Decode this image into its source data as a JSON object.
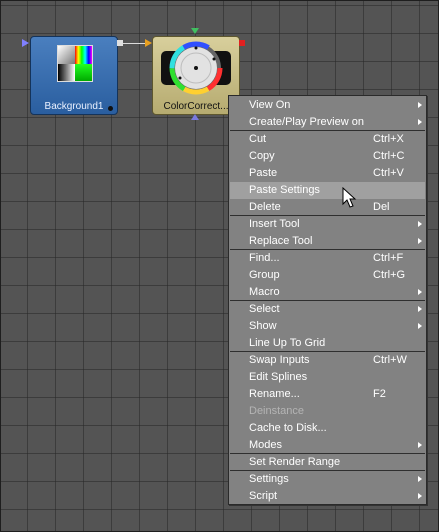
{
  "nodes": {
    "background": {
      "label": "Background1"
    },
    "color_correct": {
      "label": "ColorCorrect..."
    }
  },
  "icons": {
    "background_thumb": "gradient-swatch-icon",
    "color_wheel": "color-wheel-icon",
    "cursor": "mouse-cursor-icon"
  },
  "colors": {
    "canvas": "#545454",
    "background_node": "#3a6fae",
    "color_correct_node": "#c9bf86",
    "menu_bg": "#828282",
    "menu_highlight": "#a0a0a0",
    "menu_text": "#ffffff"
  },
  "context_menu": {
    "items": [
      {
        "label": "View On",
        "shortcut": "",
        "submenu": true,
        "enabled": true,
        "selected": false
      },
      {
        "label": "Create/Play Preview on",
        "shortcut": "",
        "submenu": true,
        "enabled": true,
        "selected": false
      },
      {
        "label": "Cut",
        "shortcut": "Ctrl+X",
        "submenu": false,
        "enabled": true,
        "selected": false
      },
      {
        "label": "Copy",
        "shortcut": "Ctrl+C",
        "submenu": false,
        "enabled": true,
        "selected": false
      },
      {
        "label": "Paste",
        "shortcut": "Ctrl+V",
        "submenu": false,
        "enabled": true,
        "selected": false
      },
      {
        "label": "Paste Settings",
        "shortcut": "",
        "submenu": false,
        "enabled": true,
        "selected": true
      },
      {
        "label": "Delete",
        "shortcut": "Del",
        "submenu": false,
        "enabled": true,
        "selected": false
      },
      {
        "label": "Insert Tool",
        "shortcut": "",
        "submenu": true,
        "enabled": true,
        "selected": false
      },
      {
        "label": "Replace Tool",
        "shortcut": "",
        "submenu": true,
        "enabled": true,
        "selected": false
      },
      {
        "label": "Find...",
        "shortcut": "Ctrl+F",
        "submenu": false,
        "enabled": true,
        "selected": false
      },
      {
        "label": "Group",
        "shortcut": "Ctrl+G",
        "submenu": false,
        "enabled": true,
        "selected": false
      },
      {
        "label": "Macro",
        "shortcut": "",
        "submenu": true,
        "enabled": true,
        "selected": false
      },
      {
        "label": "Select",
        "shortcut": "",
        "submenu": true,
        "enabled": true,
        "selected": false
      },
      {
        "label": "Show",
        "shortcut": "",
        "submenu": true,
        "enabled": true,
        "selected": false
      },
      {
        "label": "Line Up To Grid",
        "shortcut": "",
        "submenu": false,
        "enabled": true,
        "selected": false
      },
      {
        "label": "Swap Inputs",
        "shortcut": "Ctrl+W",
        "submenu": false,
        "enabled": true,
        "selected": false
      },
      {
        "label": "Edit Splines",
        "shortcut": "",
        "submenu": false,
        "enabled": true,
        "selected": false
      },
      {
        "label": "Rename...",
        "shortcut": "F2",
        "submenu": false,
        "enabled": true,
        "selected": false
      },
      {
        "label": "Deinstance",
        "shortcut": "",
        "submenu": false,
        "enabled": false,
        "selected": false
      },
      {
        "label": "Cache to Disk...",
        "shortcut": "",
        "submenu": false,
        "enabled": true,
        "selected": false
      },
      {
        "label": "Modes",
        "shortcut": "",
        "submenu": true,
        "enabled": true,
        "selected": false
      },
      {
        "label": "Set Render Range",
        "shortcut": "",
        "submenu": false,
        "enabled": true,
        "selected": false
      },
      {
        "label": "Settings",
        "shortcut": "",
        "submenu": true,
        "enabled": true,
        "selected": false
      },
      {
        "label": "Script",
        "shortcut": "",
        "submenu": true,
        "enabled": true,
        "selected": false
      }
    ]
  }
}
